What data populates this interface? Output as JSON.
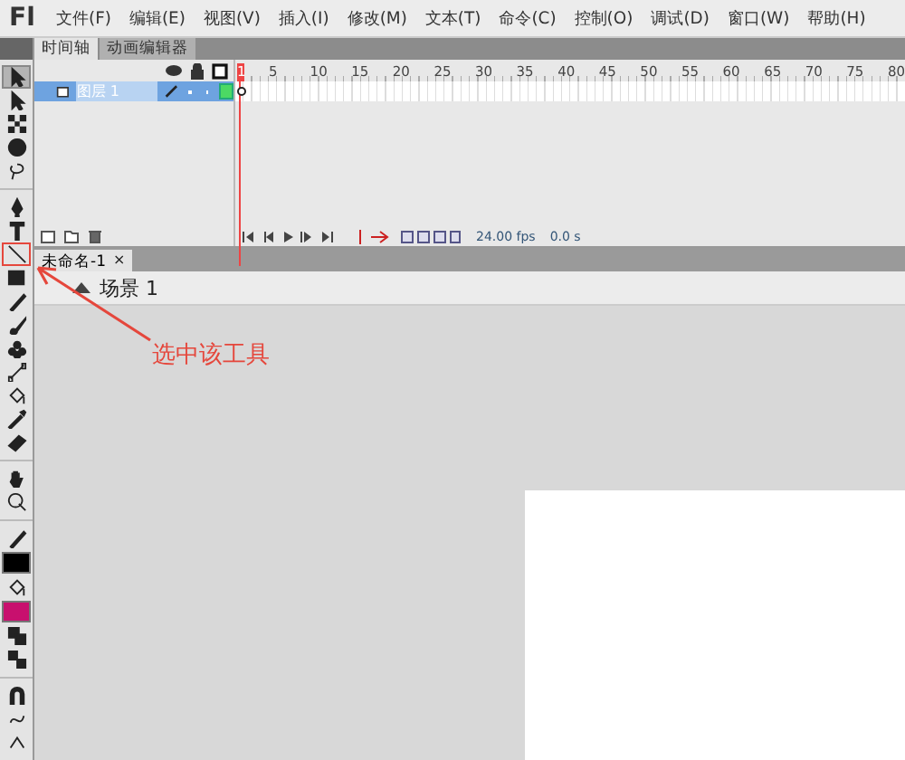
{
  "app_logo": "Fl",
  "menu": [
    "文件(F)",
    "编辑(E)",
    "视图(V)",
    "插入(I)",
    "修改(M)",
    "文本(T)",
    "命令(C)",
    "控制(O)",
    "调试(D)",
    "窗口(W)",
    "帮助(H)"
  ],
  "timeline_tabs": [
    {
      "label": "时间轴",
      "selected": true
    },
    {
      "label": "动画编辑器",
      "selected": false
    }
  ],
  "layers": [
    {
      "name": "图层 1",
      "selected": true
    }
  ],
  "frame_numbers": [
    "1",
    "5",
    "10",
    "15",
    "20",
    "25",
    "30",
    "35",
    "40",
    "45",
    "50",
    "55",
    "60",
    "65",
    "70",
    "75",
    "80"
  ],
  "timeline_status": {
    "fps": "24.00 fps",
    "time": "0.0 s"
  },
  "document_tab": {
    "title": "未命名-1",
    "close": "×"
  },
  "scene": "场景 1",
  "tool_groups": [
    [
      {
        "kind": "selection",
        "selected": true,
        "marked": false
      },
      {
        "kind": "subselection",
        "selected": false,
        "marked": false
      },
      {
        "kind": "transform",
        "selected": false,
        "marked": false
      },
      {
        "kind": "rotate3d",
        "selected": false,
        "marked": false
      },
      {
        "kind": "lasso",
        "selected": false,
        "marked": false
      }
    ],
    [
      {
        "kind": "pen",
        "selected": false,
        "marked": false
      },
      {
        "kind": "text",
        "selected": false,
        "marked": false
      },
      {
        "kind": "line",
        "selected": false,
        "marked": true
      },
      {
        "kind": "rect",
        "selected": false,
        "marked": false
      },
      {
        "kind": "pencil",
        "selected": false,
        "marked": false
      },
      {
        "kind": "brush",
        "selected": false,
        "marked": false
      },
      {
        "kind": "deco",
        "selected": false,
        "marked": false
      },
      {
        "kind": "bone",
        "selected": false,
        "marked": false
      },
      {
        "kind": "bucket",
        "selected": false,
        "marked": false
      },
      {
        "kind": "dropper",
        "selected": false,
        "marked": false
      },
      {
        "kind": "eraser",
        "selected": false,
        "marked": false
      }
    ],
    [
      {
        "kind": "hand",
        "selected": false,
        "marked": false
      },
      {
        "kind": "zoom",
        "selected": false,
        "marked": false
      }
    ],
    [
      {
        "kind": "stroke",
        "selected": false,
        "marked": false
      },
      {
        "kind": "swatch",
        "color": "#000000"
      },
      {
        "kind": "fill",
        "selected": false,
        "marked": false
      },
      {
        "kind": "swatch",
        "color": "#c8106e"
      },
      {
        "kind": "bw",
        "selected": false,
        "marked": false
      },
      {
        "kind": "swap",
        "selected": false,
        "marked": false
      }
    ],
    [
      {
        "kind": "snap",
        "selected": false,
        "marked": false
      },
      {
        "kind": "smooth",
        "selected": false,
        "marked": false
      },
      {
        "kind": "straighten",
        "selected": false,
        "marked": false
      }
    ]
  ],
  "annotation": {
    "text": "选中该工具"
  }
}
